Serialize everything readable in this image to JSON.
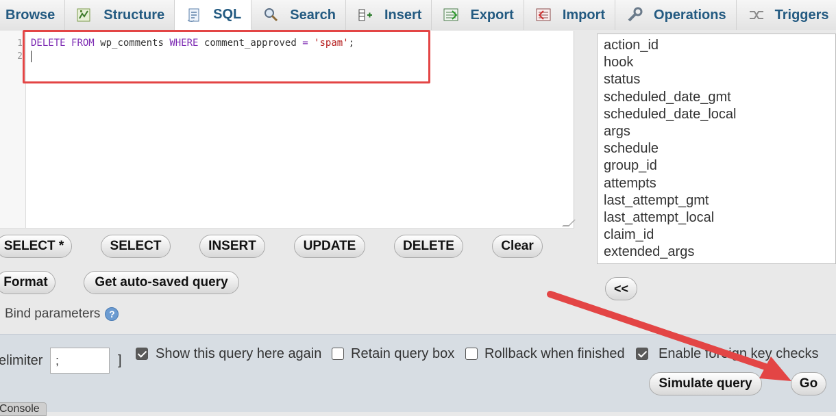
{
  "tabs": [
    {
      "label": "Browse",
      "icon": "browse-icon"
    },
    {
      "label": "Structure",
      "icon": "structure-icon"
    },
    {
      "label": "SQL",
      "icon": "sql-icon",
      "active": true
    },
    {
      "label": "Search",
      "icon": "search-icon"
    },
    {
      "label": "Insert",
      "icon": "insert-icon"
    },
    {
      "label": "Export",
      "icon": "export-icon"
    },
    {
      "label": "Import",
      "icon": "import-icon"
    },
    {
      "label": "Operations",
      "icon": "operations-icon"
    },
    {
      "label": "Triggers",
      "icon": "triggers-icon"
    }
  ],
  "editor": {
    "line_numbers": [
      "1",
      "2"
    ],
    "tokens": {
      "delete": "DELETE",
      "from": "FROM",
      "table": " wp_comments ",
      "where": "WHERE",
      "column": " comment_approved ",
      "eq": "=",
      "value": "'spam'",
      "end": ";"
    }
  },
  "columns": [
    "action_id",
    "hook",
    "status",
    "scheduled_date_gmt",
    "scheduled_date_local",
    "args",
    "schedule",
    "group_id",
    "attempts",
    "last_attempt_gmt",
    "last_attempt_local",
    "claim_id",
    "extended_args"
  ],
  "buttons": {
    "select_all": "SELECT *",
    "select": "SELECT",
    "insert": "INSERT",
    "update": "UPDATE",
    "delete": "DELETE",
    "clear": "Clear",
    "format": "Format",
    "autosaved": "Get auto-saved query",
    "insert_column": "<<",
    "simulate": "Simulate query",
    "go": "Go"
  },
  "bind_parameters": "Bind parameters",
  "bottom": {
    "delimiter_label": "elimiter",
    "delimiter_value": ";",
    "bracket": "]",
    "show_query": {
      "label": "Show this query here again",
      "checked": true
    },
    "retain_box": {
      "label": "Retain query box",
      "checked": false
    },
    "rollback": {
      "label": "Rollback when finished",
      "checked": false
    },
    "foreign_keys": {
      "label": "Enable foreign key checks",
      "checked": true
    }
  },
  "console_label": "Console",
  "colors": {
    "tab_text": "#235a81",
    "keyword": "#7d2bb3",
    "string": "#b51d1d",
    "annotation_red": "#e34545"
  }
}
